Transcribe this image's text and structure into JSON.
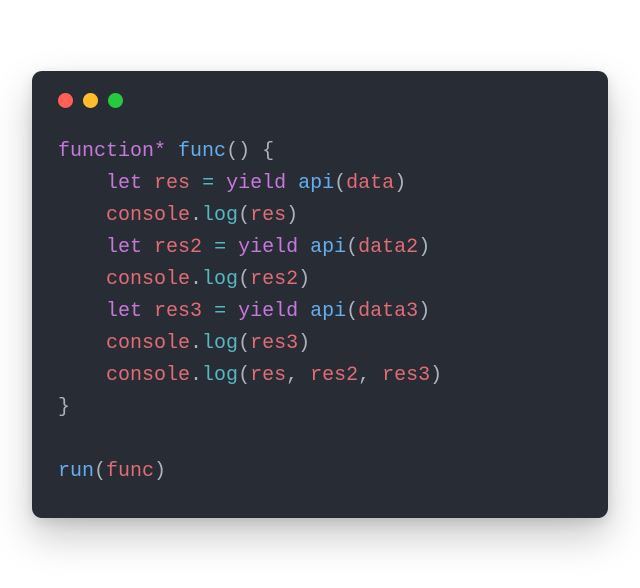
{
  "titlebar": {
    "dot_red": "close",
    "dot_yellow": "minimize",
    "dot_green": "zoom"
  },
  "code": {
    "kw_function": "function",
    "star": "*",
    "fn_name": "func",
    "paren_open": "(",
    "paren_close": ")",
    "brace_open": "{",
    "brace_close": "}",
    "indent": "    ",
    "kw_let": "let",
    "id_res": "res",
    "id_res2": "res2",
    "id_res3": "res3",
    "eq": "=",
    "kw_yield": "yield",
    "fn_api": "api",
    "id_data": "data",
    "id_data2": "data2",
    "id_data3": "data3",
    "id_console": "console",
    "dot": ".",
    "fn_log": "log",
    "comma_sp": ", ",
    "fn_run": "run",
    "sp": " "
  }
}
